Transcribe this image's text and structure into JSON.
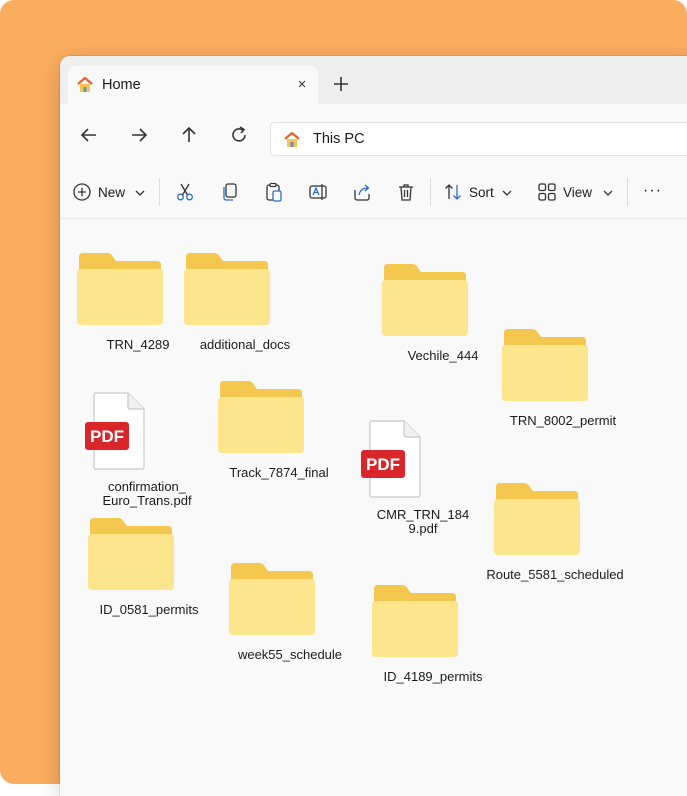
{
  "tab": {
    "label": "Home",
    "close": "×"
  },
  "address": {
    "text": "This PC"
  },
  "commands": {
    "new_label": "New",
    "sort_label": "Sort",
    "view_label": "View",
    "more": "···"
  },
  "pdf_badge": "PDF",
  "items": [
    {
      "name": "TRN_4289",
      "kind": "folder"
    },
    {
      "name": "additional_docs",
      "kind": "folder"
    },
    {
      "name": "Vechile_444",
      "kind": "folder"
    },
    {
      "name": "TRN_8002_permit",
      "kind": "folder"
    },
    {
      "name": "confirmation_\nEuro_Trans.pdf",
      "kind": "pdf"
    },
    {
      "name": "Track_7874_final",
      "kind": "folder"
    },
    {
      "name": "CMR_TRN_184\n9.pdf",
      "kind": "pdf"
    },
    {
      "name": "Route_5581_scheduled",
      "kind": "folder"
    },
    {
      "name": "ID_0581_permits",
      "kind": "folder"
    },
    {
      "name": "week55_schedule",
      "kind": "folder"
    },
    {
      "name": "ID_4189_permits",
      "kind": "folder"
    }
  ],
  "colors": {
    "backdrop": "#fbad5f",
    "folder_back": "#f4c74e",
    "folder_front": "#fde58d",
    "pdf_red": "#d9262a",
    "home_roof": "#e8622c"
  }
}
